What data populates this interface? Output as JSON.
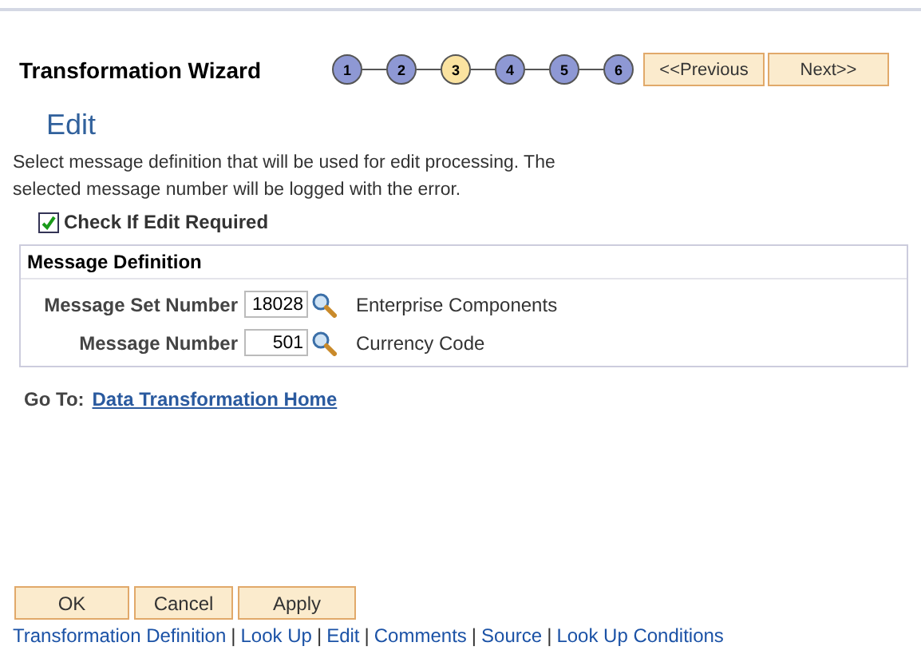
{
  "title": "Transformation Wizard",
  "steps": [
    {
      "label": "1",
      "selected": false
    },
    {
      "label": "2",
      "selected": false
    },
    {
      "label": "3",
      "selected": true
    },
    {
      "label": "4",
      "selected": false
    },
    {
      "label": "5",
      "selected": false
    },
    {
      "label": "6",
      "selected": false
    }
  ],
  "nav_buttons": [
    "<<Previous",
    "Next>>"
  ],
  "heading": "Edit",
  "description": "Select message definition that will be used for edit processing. The selected message number will be logged with the error.",
  "checkbox": {
    "label": "Check If Edit Required",
    "checked": true
  },
  "group": {
    "title": "Message Definition",
    "fields": [
      {
        "label": "Message Set Number",
        "value": "18028",
        "description": "Enterprise Components"
      },
      {
        "label": "Message Number",
        "value": "501",
        "description": "Currency Code"
      }
    ]
  },
  "goto": {
    "label": "Go To:",
    "link": "Data Transformation Home"
  },
  "buttons": [
    "OK",
    "Cancel",
    "Apply"
  ],
  "footer": {
    "separator": "|",
    "links": [
      "Transformation Definition",
      "Look Up",
      "Edit",
      "Comments",
      "Source",
      "Look Up Conditions"
    ]
  }
}
